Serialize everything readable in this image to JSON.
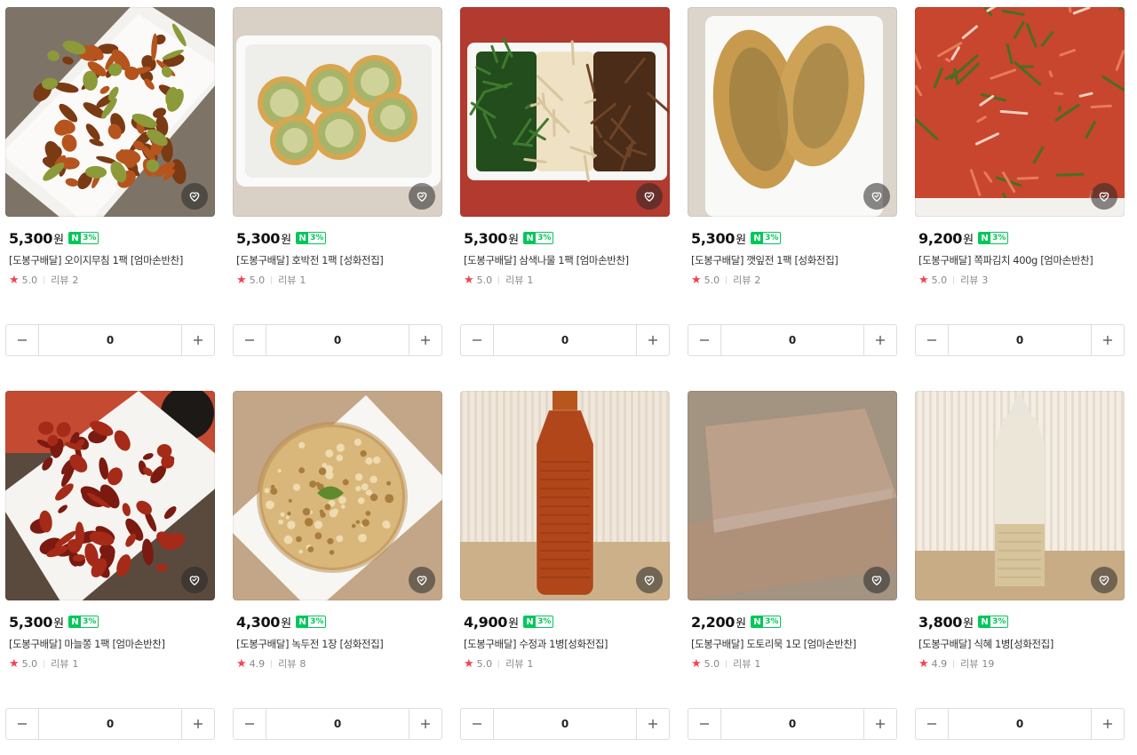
{
  "currency_unit": "원",
  "npay_badge": {
    "mark": "N",
    "percent": "3%"
  },
  "products": [
    {
      "price": "5,300",
      "name": "[도봉구배달] 오이지무침 1팩 [엄마손반찬]",
      "rating": "5.0",
      "review_label": "리뷰",
      "review_count": "2",
      "quantity": "0",
      "image": "cucumber-side-dish"
    },
    {
      "price": "5,300",
      "name": "[도봉구배달] 호박전 1팩 [성화전집]",
      "rating": "5.0",
      "review_label": "리뷰",
      "review_count": "1",
      "quantity": "0",
      "image": "zucchini-jeon"
    },
    {
      "price": "5,300",
      "name": "[도봉구배달] 삼색나물 1팩 [엄마손반찬]",
      "rating": "5.0",
      "review_label": "리뷰",
      "review_count": "1",
      "quantity": "0",
      "image": "three-color-namul"
    },
    {
      "price": "5,300",
      "name": "[도봉구배달] 깻잎전 1팩 [성화전집]",
      "rating": "5.0",
      "review_label": "리뷰",
      "review_count": "2",
      "quantity": "0",
      "image": "perilla-leaf-jeon"
    },
    {
      "price": "9,200",
      "name": "[도봉구배달] 쪽파김치 400g [엄마손반찬]",
      "rating": "5.0",
      "review_label": "리뷰",
      "review_count": "3",
      "quantity": "0",
      "image": "green-onion-kimchi"
    },
    {
      "price": "5,300",
      "name": "[도봉구배달] 마늘쫑 1팩 [엄마손반찬]",
      "rating": "5.0",
      "review_label": "리뷰",
      "review_count": "1",
      "quantity": "0",
      "image": "garlic-scape"
    },
    {
      "price": "4,300",
      "name": "[도봉구배달] 녹두전 1장 [성화전집]",
      "rating": "4.9",
      "review_label": "리뷰",
      "review_count": "8",
      "quantity": "0",
      "image": "mung-bean-pancake"
    },
    {
      "price": "4,900",
      "name": "[도봉구배달] 수정과 1병[성화전집]",
      "rating": "5.0",
      "review_label": "리뷰",
      "review_count": "1",
      "quantity": "0",
      "image": "sujeonggwa-bottle"
    },
    {
      "price": "2,200",
      "name": "[도봉구배달] 도토리묵 1모 [엄마손반찬]",
      "rating": "5.0",
      "review_label": "리뷰",
      "review_count": "1",
      "quantity": "0",
      "image": "acorn-jelly"
    },
    {
      "price": "3,800",
      "name": "[도봉구배달] 식혜 1병[성화전집]",
      "rating": "4.9",
      "review_label": "리뷰",
      "review_count": "19",
      "quantity": "0",
      "image": "sikhye-bottle"
    }
  ],
  "colors": {
    "star": "#f04452",
    "npay_green": "#03c75a"
  }
}
